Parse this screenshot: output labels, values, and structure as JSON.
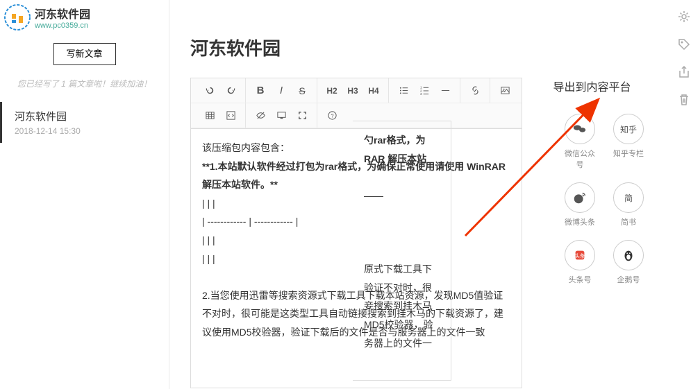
{
  "watermark": {
    "title": "河东软件园",
    "url": "www.pc0359.cn"
  },
  "sidebar": {
    "new_article": "写新文章",
    "hint": "您已经写了 1 篇文章啦！继续加油！",
    "article": {
      "title": "河东软件园",
      "date": "2018-12-14 15:30"
    }
  },
  "page_title": "河东软件园",
  "export": {
    "title": "导出到内容平台",
    "platforms": [
      {
        "label": "微信公众号",
        "icon": "wechat"
      },
      {
        "label": "知乎专栏",
        "icon": "zhihu",
        "text": "知乎"
      },
      {
        "label": "微博头条",
        "icon": "weibo"
      },
      {
        "label": "简书",
        "icon": "jianshu",
        "text": "简"
      },
      {
        "label": "头条号",
        "icon": "toutiao"
      },
      {
        "label": "企鹅号",
        "icon": "penguin"
      }
    ]
  },
  "editor": {
    "line1": "该压缩包内容包含：",
    "line2": "**1.本站默认软件经过打包为rar格式，为确保正常使用请使用 WinRAR 解压本站软件。**",
    "line3": "|   |   |",
    "line4": "| ------------ | ------------ |",
    "line5": "|   |   |",
    "line6": "|   |   |",
    "line7": "",
    "line8": "2.当您使用迅雷等搜索资源式下载工具下载本站资源，发现MD5值验证不对时，很可能是这类型工具自动链接搜索到挂木马的下载资源了，建议使用MD5校验器，验证下载后的文件是否与服务器上的文件一致"
  },
  "preview": {
    "line1": "勺rar格式，为",
    "line2": "RAR 解压本站",
    "line3": "——",
    "line4": "原式下载工具下",
    "line5": "验证不对时，很",
    "line6": "妾搜索到挂木马",
    "line7": "MD5校验器，验",
    "line8": "务器上的文件一"
  }
}
